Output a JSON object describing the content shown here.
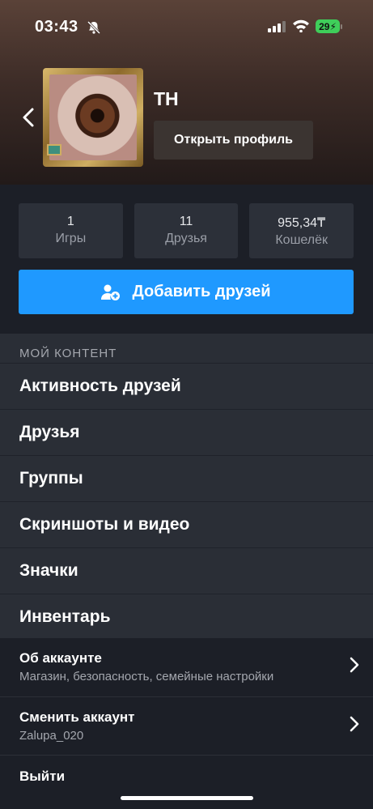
{
  "status_bar": {
    "time": "03:43",
    "battery": "29"
  },
  "profile": {
    "username": "TH",
    "open_profile_label": "Открыть профиль"
  },
  "stats": [
    {
      "value": "1",
      "label": "Игры"
    },
    {
      "value": "11",
      "label": "Друзья"
    },
    {
      "value": "955,34₸",
      "label": "Кошелёк"
    }
  ],
  "add_friends_label": "Добавить друзей",
  "my_content": {
    "title": "МОЙ КОНТЕНТ",
    "items": [
      "Активность друзей",
      "Друзья",
      "Группы",
      "Скриншоты и видео",
      "Значки",
      "Инвентарь"
    ]
  },
  "account": {
    "about": {
      "title": "Об аккаунте",
      "subtitle": "Магазин, безопасность, семейные настройки"
    },
    "switch": {
      "title": "Сменить аккаунт",
      "subtitle": "Zalupa_020"
    },
    "logout": "Выйти"
  },
  "colors": {
    "accent": "#1f99ff",
    "battery": "#3fce5a",
    "background": "#1c1f27"
  }
}
